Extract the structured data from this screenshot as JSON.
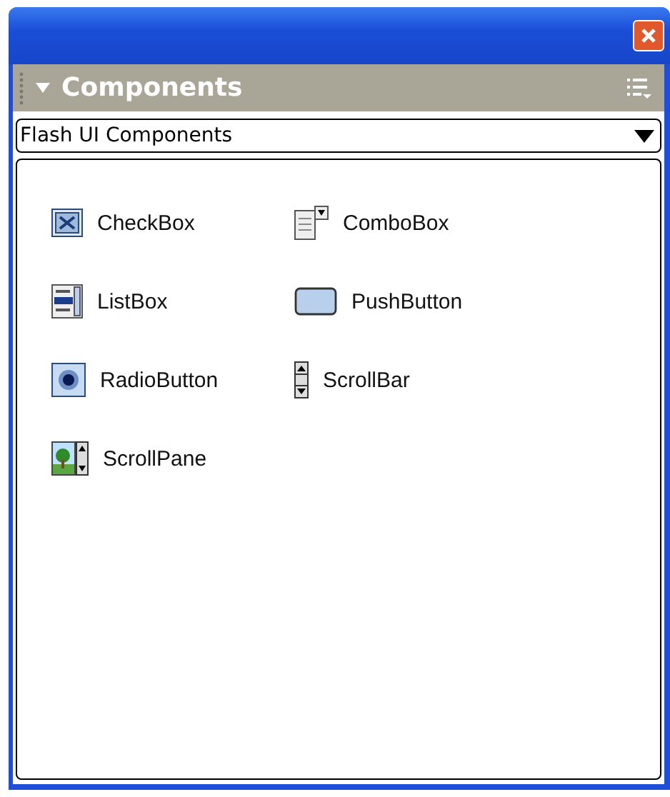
{
  "panel": {
    "title": "Components"
  },
  "library": {
    "value": "Flash UI Components"
  },
  "components": [
    {
      "label": "CheckBox",
      "kind": "checkbox"
    },
    {
      "label": "ComboBox",
      "kind": "combobox"
    },
    {
      "label": "ListBox",
      "kind": "listbox"
    },
    {
      "label": "PushButton",
      "kind": "pushbutton"
    },
    {
      "label": "RadioButton",
      "kind": "radiobutton"
    },
    {
      "label": "ScrollBar",
      "kind": "scrollbar"
    },
    {
      "label": "ScrollPane",
      "kind": "scrollpane"
    }
  ]
}
